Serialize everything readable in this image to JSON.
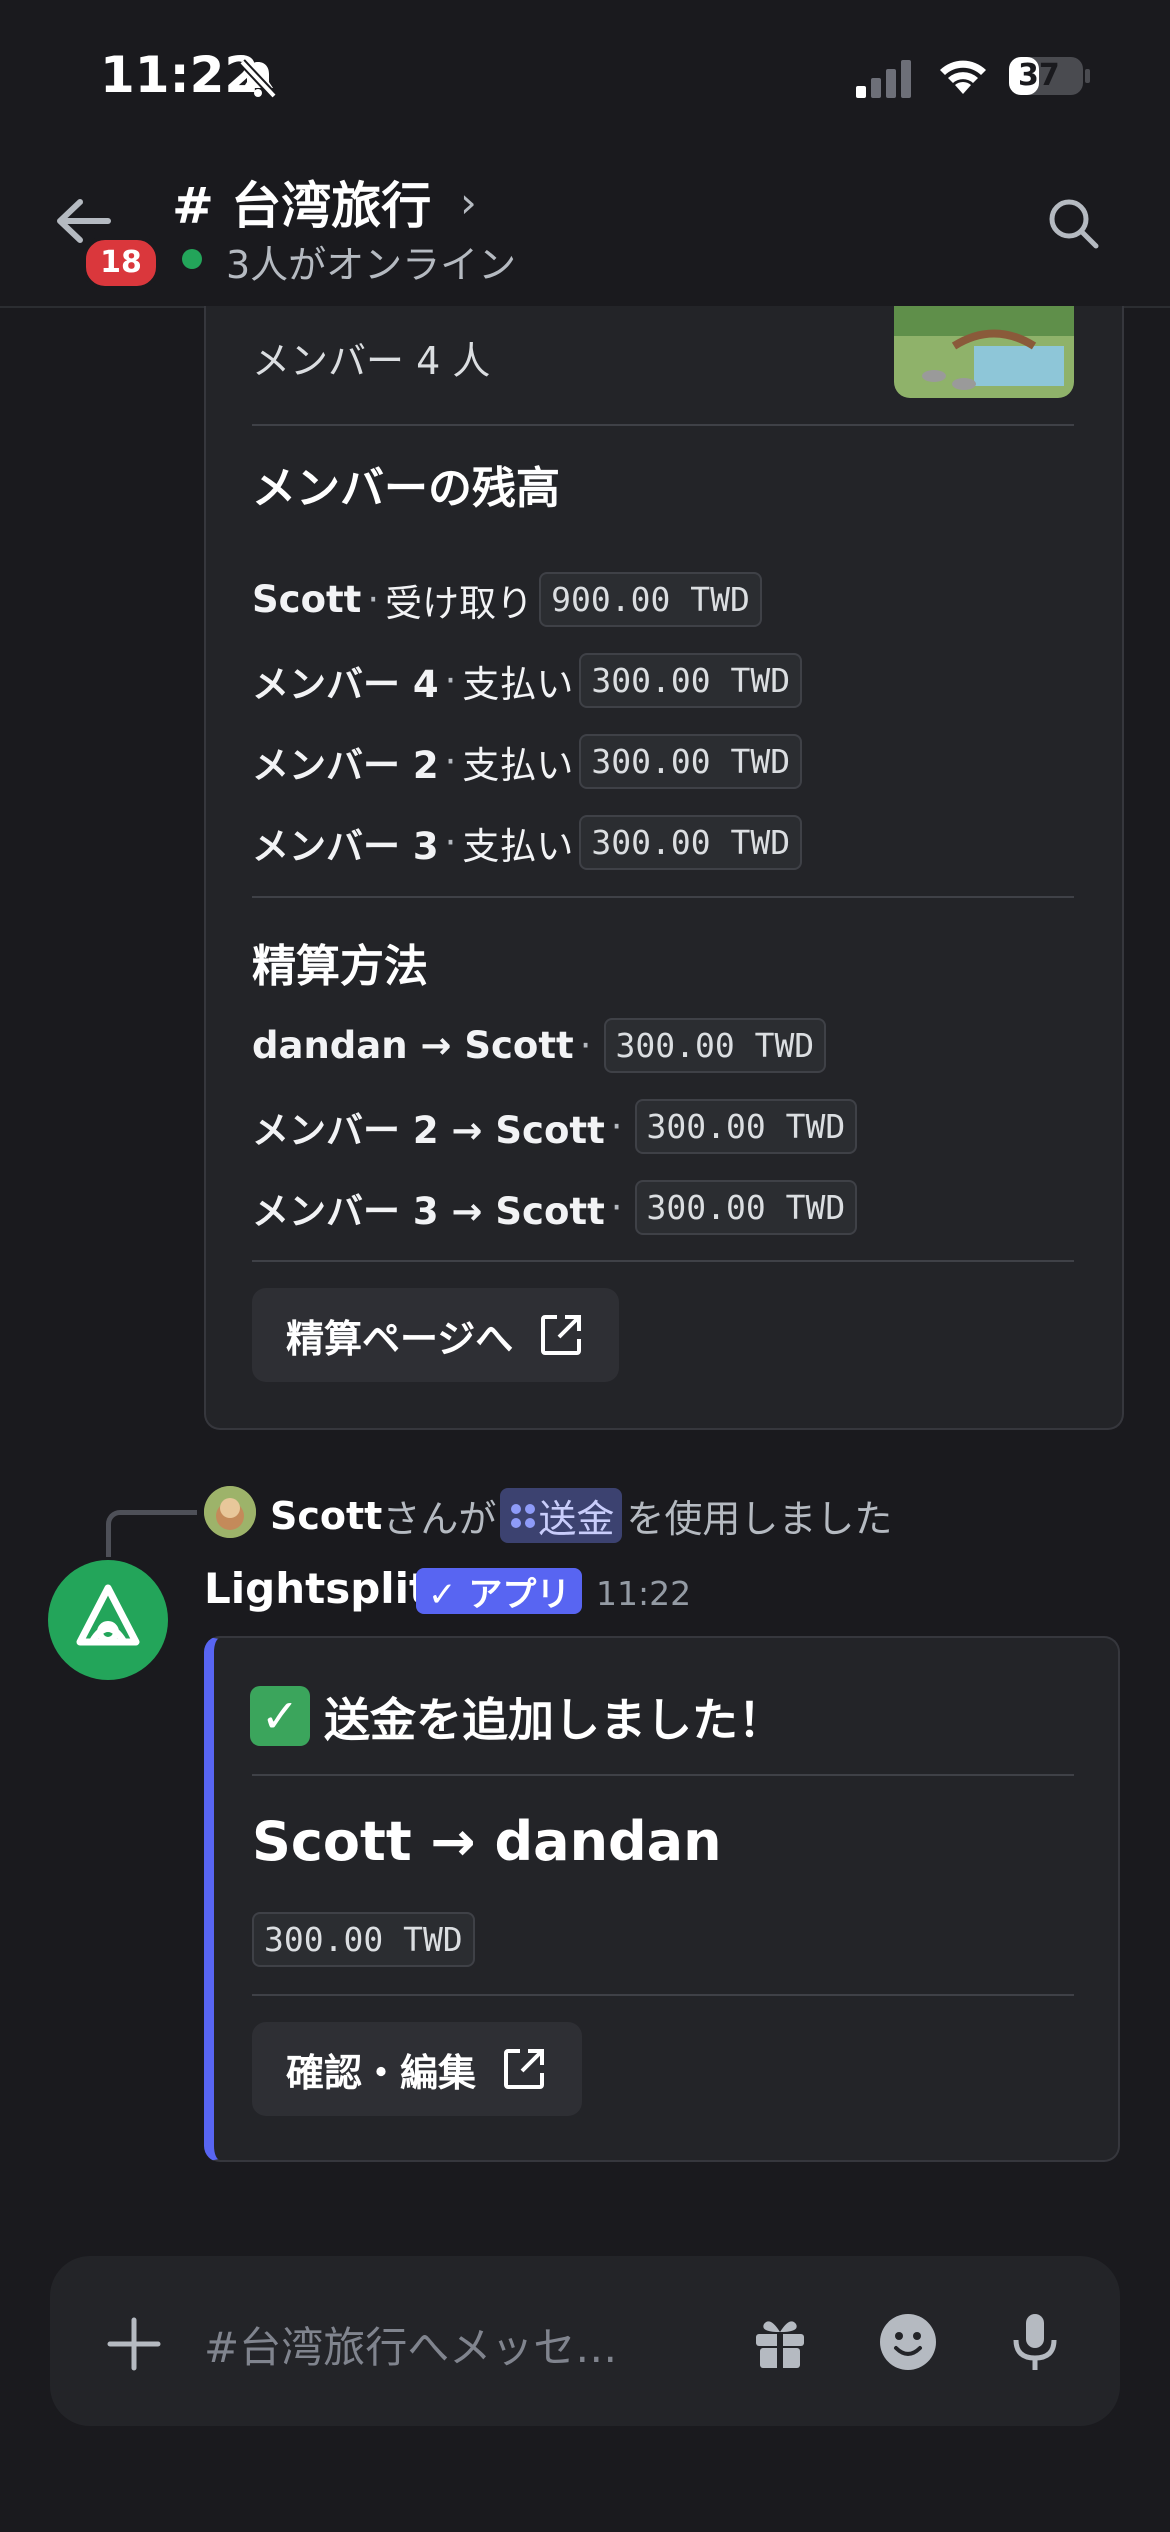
{
  "status_bar": {
    "time": "11:22",
    "battery": "37"
  },
  "header": {
    "unread_badge": "18",
    "channel_title": "# 台湾旅行",
    "online_text": "3人がオンライン"
  },
  "embed1": {
    "members": "メンバー 4 人",
    "balances_title": "メンバーの残高",
    "balances": [
      {
        "name": "Scott",
        "sep": "·",
        "action": "受け取り",
        "amount": "900.00 TWD"
      },
      {
        "name": "メンバー 4",
        "sep": "·",
        "action": "支払い",
        "amount": "300.00 TWD"
      },
      {
        "name": "メンバー 2",
        "sep": "·",
        "action": "支払い",
        "amount": "300.00 TWD"
      },
      {
        "name": "メンバー 3",
        "sep": "·",
        "action": "支払い",
        "amount": "300.00 TWD"
      }
    ],
    "settle_title": "精算方法",
    "settlements": [
      {
        "pair": "dandan → Scott",
        "sep": "·",
        "amount": "300.00 TWD"
      },
      {
        "pair": "メンバー 2 → Scott",
        "sep": "·",
        "amount": "300.00 TWD"
      },
      {
        "pair": "メンバー 3 → Scott",
        "sep": "·",
        "amount": "300.00 TWD"
      }
    ],
    "button_label": "精算ページへ"
  },
  "reply": {
    "user": "Scott",
    "pre": "さんが",
    "command": "送金",
    "post": "を使用しました"
  },
  "message": {
    "bot_name": "Lightsplit",
    "app_tag": "✓ アプリ",
    "time": "11:22",
    "embed_check": "✓",
    "embed_title": "送金を追加しました！",
    "embed_pair": "Scott → dandan",
    "embed_amount": "300.00 TWD",
    "button_label": "確認・編集"
  },
  "composer": {
    "placeholder": "#台湾旅行へメッセ…"
  },
  "colors": {
    "accent": "#5865f2",
    "online": "#23a55a",
    "badge": "#da373c",
    "bot_avatar": "#23a55a"
  }
}
